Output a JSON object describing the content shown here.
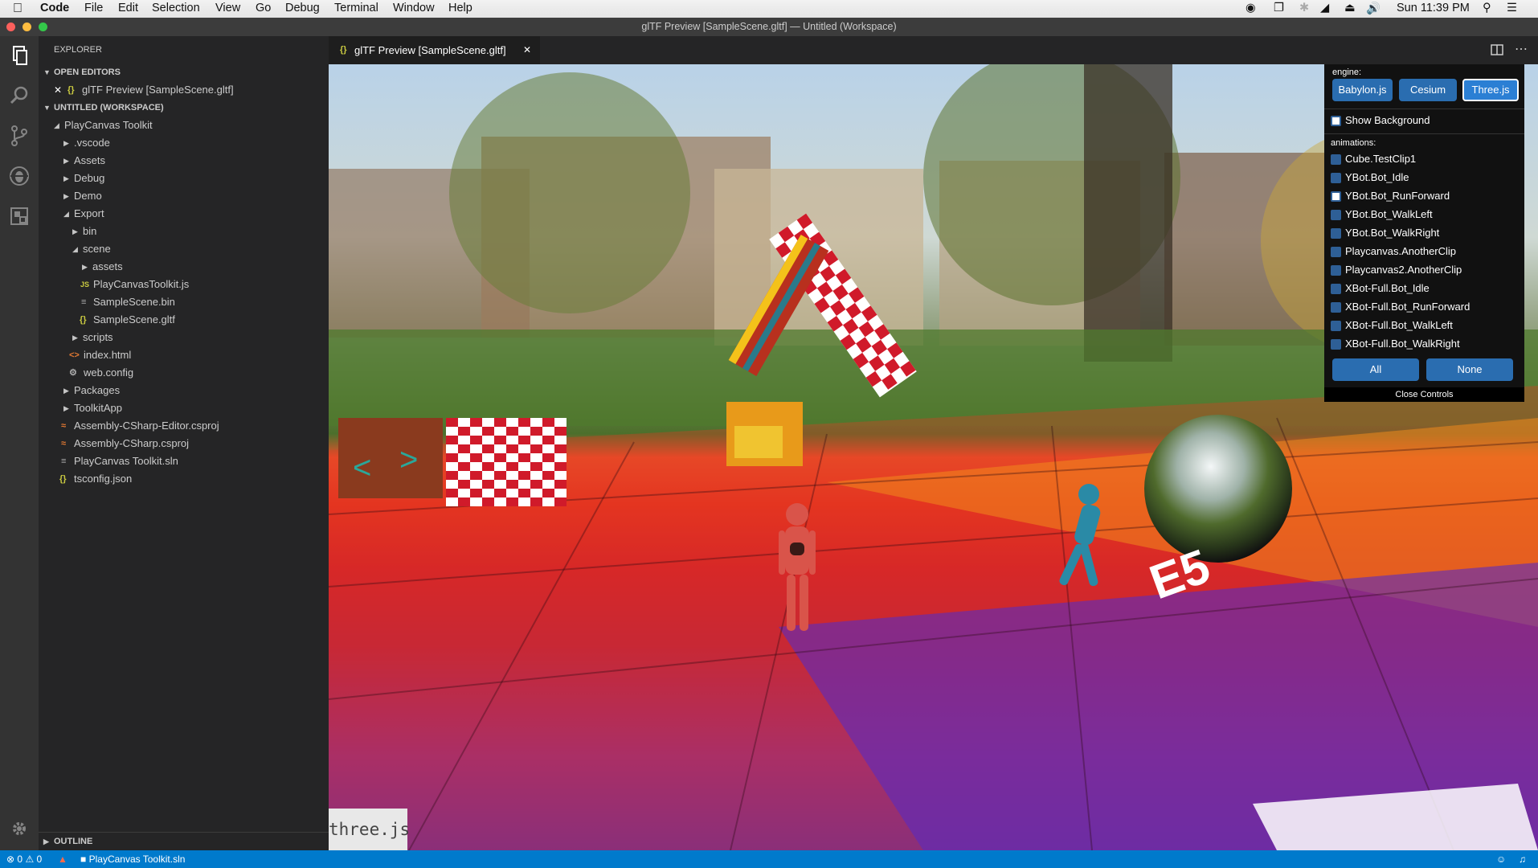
{
  "menubar": {
    "app": "Code",
    "items": [
      "File",
      "Edit",
      "Selection",
      "View",
      "Go",
      "Debug",
      "Terminal",
      "Window",
      "Help"
    ],
    "clock": "Sun 11:39 PM"
  },
  "window": {
    "title": "glTF Preview [SampleScene.gltf] — Untitled (Workspace)"
  },
  "explorer": {
    "title": "EXPLORER",
    "open_editors_label": "OPEN EDITORS",
    "open_editor_item": "glTF Preview [SampleScene.gltf]",
    "workspace_label": "UNTITLED (WORKSPACE)",
    "tree": [
      {
        "label": "PlayCanvas Toolkit"
      },
      {
        "label": ".vscode"
      },
      {
        "label": "Assets"
      },
      {
        "label": "Debug"
      },
      {
        "label": "Demo"
      },
      {
        "label": "Export"
      },
      {
        "label": "bin"
      },
      {
        "label": "scene"
      },
      {
        "label": "assets"
      },
      {
        "label": "PlayCanvasToolkit.js",
        "icon": "JS"
      },
      {
        "label": "SampleScene.bin"
      },
      {
        "label": "SampleScene.gltf",
        "icon": "{}"
      },
      {
        "label": "scripts"
      },
      {
        "label": "index.html",
        "icon": "<>"
      },
      {
        "label": "web.config"
      },
      {
        "label": "Packages"
      },
      {
        "label": "ToolkitApp"
      },
      {
        "label": "Assembly-CSharp-Editor.csproj"
      },
      {
        "label": "Assembly-CSharp.csproj"
      },
      {
        "label": "PlayCanvas Toolkit.sln"
      },
      {
        "label": "tsconfig.json",
        "icon": "{}"
      }
    ],
    "outline_label": "OUTLINE"
  },
  "editor": {
    "tab_label": "glTF Preview [SampleScene.gltf]",
    "watermark": "three.js"
  },
  "controls": {
    "engine_label": "engine:",
    "engines": [
      "Babylon.js",
      "Cesium",
      "Three.js"
    ],
    "selected_engine": "Three.js",
    "show_background_label": "Show Background",
    "animations_label": "animations:",
    "animations": [
      {
        "name": "Cube.TestClip1",
        "checked": false
      },
      {
        "name": "YBot.Bot_Idle",
        "checked": false
      },
      {
        "name": "YBot.Bot_RunForward",
        "checked": true
      },
      {
        "name": "YBot.Bot_WalkLeft",
        "checked": false
      },
      {
        "name": "YBot.Bot_WalkRight",
        "checked": false
      },
      {
        "name": "Playcanvas.AnotherClip",
        "checked": false
      },
      {
        "name": "Playcanvas2.AnotherClip",
        "checked": false
      },
      {
        "name": "XBot-Full.Bot_Idle",
        "checked": false
      },
      {
        "name": "XBot-Full.Bot_RunForward",
        "checked": false
      },
      {
        "name": "XBot-Full.Bot_WalkLeft",
        "checked": false
      },
      {
        "name": "XBot-Full.Bot_WalkRight",
        "checked": false
      }
    ],
    "all_label": "All",
    "none_label": "None",
    "close_label": "Close Controls"
  },
  "statusbar": {
    "errors": "0",
    "warnings": "0",
    "solution": "PlayCanvas Toolkit.sln"
  }
}
